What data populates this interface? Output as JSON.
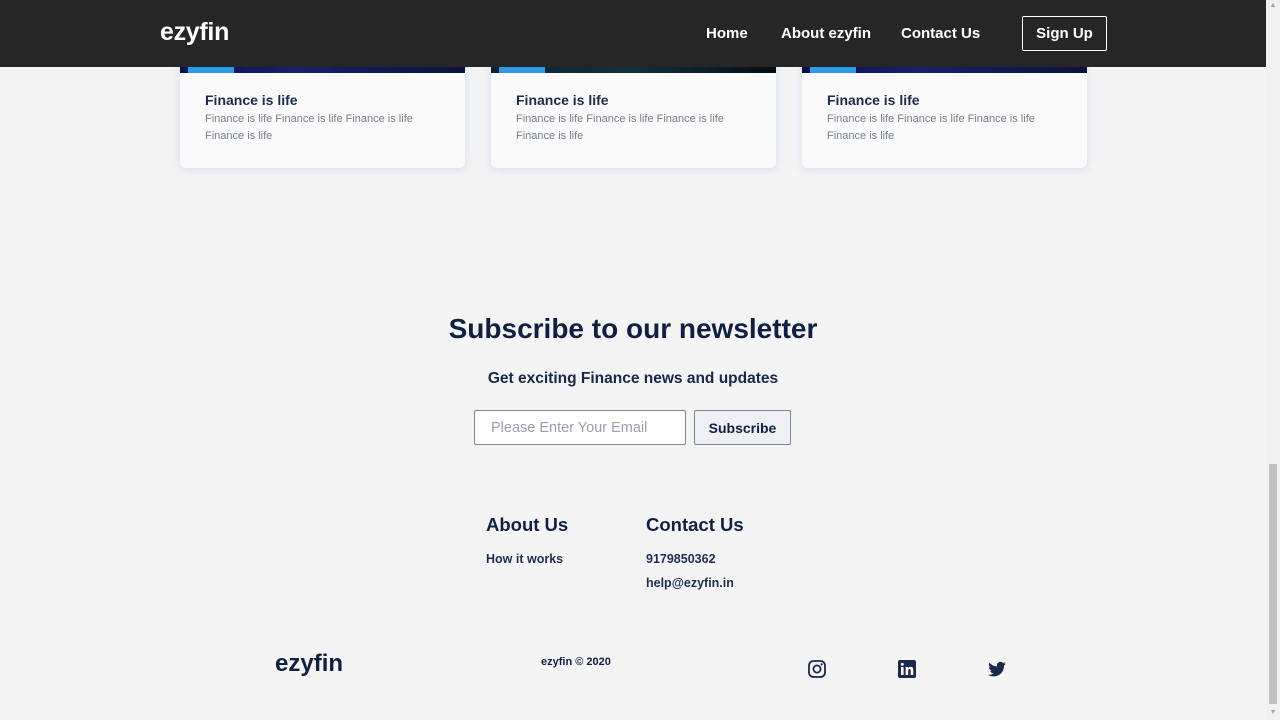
{
  "navbar": {
    "brand": "ezyfin",
    "links": [
      "Home",
      "About ezyfin",
      "Contact Us"
    ],
    "signup_label": "Sign Up"
  },
  "cards": [
    {
      "title": "Finance is life",
      "text": "Finance is life Finance is life Finance is life Finance is life"
    },
    {
      "title": "Finance is life",
      "text": "Finance is life Finance is life Finance is life Finance is life"
    },
    {
      "title": "Finance is life",
      "text": "Finance is life Finance is life Finance is life Finance is life"
    }
  ],
  "newsletter": {
    "title": "Subscribe to our newsletter",
    "subtitle": "Get exciting Finance news and updates",
    "email_placeholder": "Please Enter Your Email",
    "subscribe_label": "Subscribe"
  },
  "footer": {
    "about": {
      "heading": "About Us",
      "links": [
        "How it works"
      ]
    },
    "contact": {
      "heading": "Contact Us",
      "phone": "9179850362",
      "email": "help@ezyfin.in"
    },
    "brand": "ezyfin",
    "copyright": "ezyfin © 2020",
    "social_icons": [
      "instagram-icon",
      "linkedin-icon",
      "twitter-icon"
    ]
  },
  "colors": {
    "navbar_bg": "#262626",
    "page_bg": "#f4f4f5",
    "heading": "#0f2142",
    "card_accent": "#2d9ae8"
  }
}
